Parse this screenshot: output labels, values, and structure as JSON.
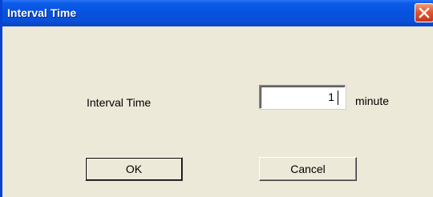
{
  "window": {
    "title": "Interval Time"
  },
  "form": {
    "field_label": "Interval Time",
    "input_value": "1",
    "unit_label": "minute"
  },
  "buttons": {
    "ok_label": "OK",
    "cancel_label": "Cancel"
  },
  "icons": {
    "close": "close-icon"
  },
  "colors": {
    "titlebar": "#0553e0",
    "close_button": "#e1552f",
    "dialog_background": "#ece9d8"
  }
}
